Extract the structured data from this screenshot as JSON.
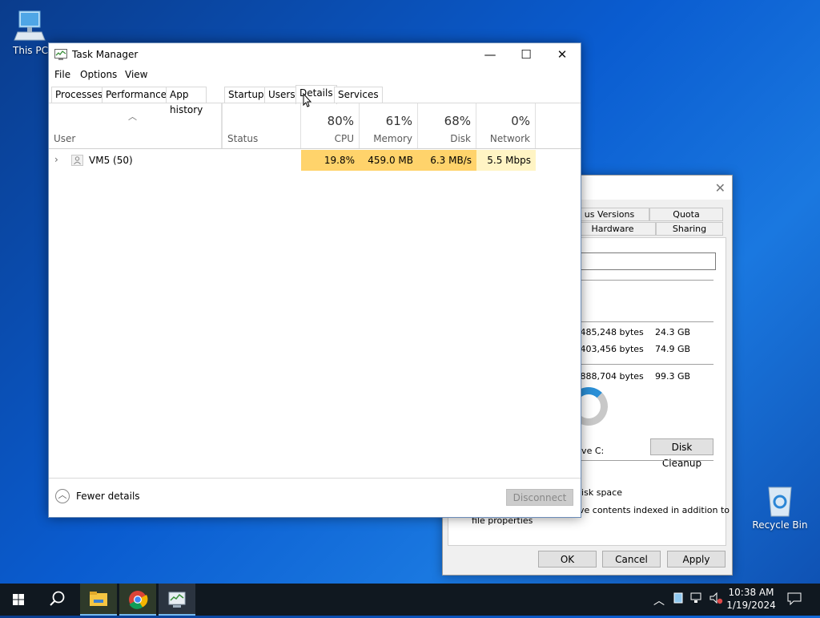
{
  "desktop": {
    "this_pc_label": "This PC",
    "recycle_bin_label": "Recycle Bin"
  },
  "task_manager": {
    "title": "Task Manager",
    "menu": [
      "File",
      "Options",
      "View"
    ],
    "tabs": [
      "Processes",
      "Performance",
      "App history",
      "Startup",
      "Users",
      "Details",
      "Services"
    ],
    "active_tab": "Details",
    "columns": {
      "user": "User",
      "status": "Status",
      "cpu": {
        "percent": "80%",
        "label": "CPU"
      },
      "memory": {
        "percent": "61%",
        "label": "Memory"
      },
      "disk": {
        "percent": "68%",
        "label": "Disk"
      },
      "network": {
        "percent": "0%",
        "label": "Network"
      }
    },
    "rows": [
      {
        "user": "VM5 (50)",
        "status": "",
        "cpu": "19.8%",
        "memory": "459.0 MB",
        "disk": "6.3 MB/s",
        "network": "5.5 Mbps"
      }
    ],
    "footer": {
      "fewer_details": "Fewer details",
      "disconnect": "Disconnect"
    }
  },
  "properties_dialog": {
    "tabs_top": [
      "us Versions",
      "Quota"
    ],
    "tabs_bottom": [
      "Hardware",
      "Sharing"
    ],
    "used_bytes": ",485,248 bytes",
    "used_size": "24.3 GB",
    "free_bytes": ",403,456 bytes",
    "free_size": "74.9 GB",
    "capacity_bytes": ",888,704 bytes",
    "capacity_size": "99.3 GB",
    "drive_label": "ive C:",
    "disk_cleanup": "Disk Cleanup",
    "compress_text": "lisk space",
    "index_text": "ve contents indexed in addition to",
    "file_props_text": "file properties",
    "ok": "OK",
    "cancel": "Cancel",
    "apply": "Apply"
  },
  "taskbar": {
    "time": "10:38 AM",
    "date": "1/19/2024"
  },
  "colors": {
    "cpu_heat": "#ffd36b",
    "memory_heat": "#ffd36b",
    "disk_heat": "#ffd36b",
    "network_heat": "#fff4c4",
    "accent": "#76b9ed"
  }
}
